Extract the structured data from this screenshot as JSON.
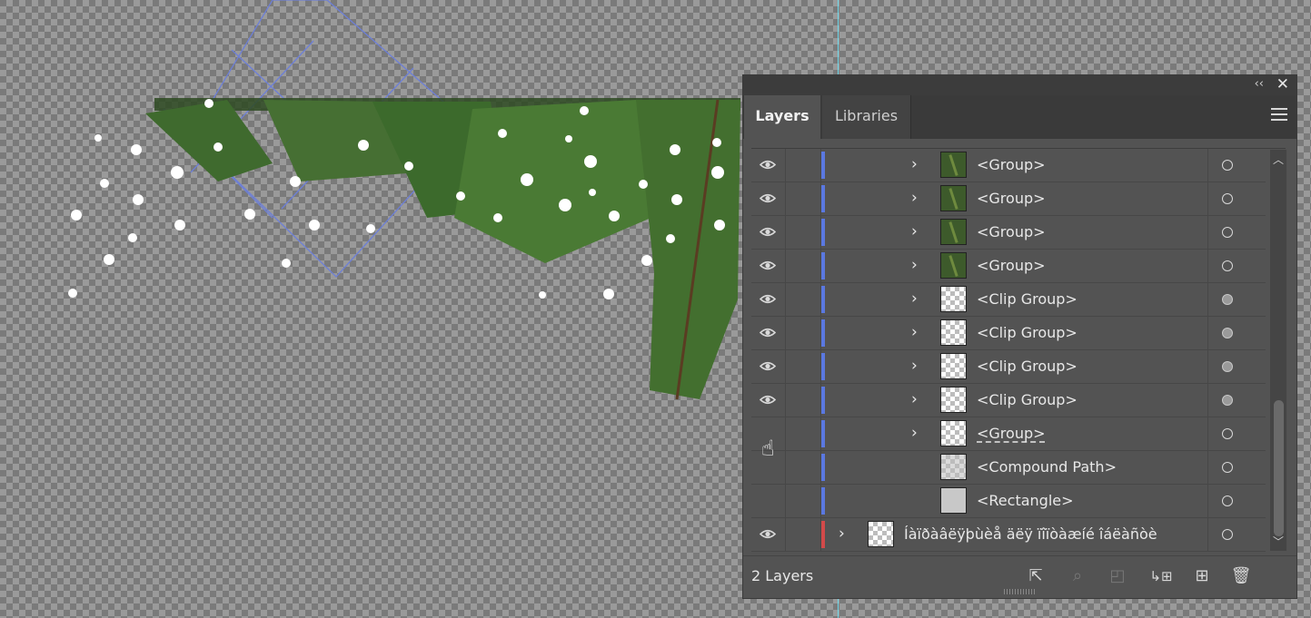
{
  "panel": {
    "tabs": [
      {
        "label": "Layers",
        "active": true
      },
      {
        "label": "Libraries",
        "active": false
      }
    ],
    "collapse_icon": "double-chevron-left-icon",
    "close_icon": "close-icon",
    "menu_icon": "hamburger-menu-icon"
  },
  "layers": {
    "rows": [
      {
        "name": "<Group>",
        "visible": true,
        "expandable": true,
        "thumb": "branch",
        "color": "#5a78e0",
        "target": "empty"
      },
      {
        "name": "<Group>",
        "visible": true,
        "expandable": true,
        "thumb": "branch",
        "color": "#5a78e0",
        "target": "empty"
      },
      {
        "name": "<Group>",
        "visible": true,
        "expandable": true,
        "thumb": "branch",
        "color": "#5a78e0",
        "target": "empty"
      },
      {
        "name": "<Group>",
        "visible": true,
        "expandable": true,
        "thumb": "branch",
        "color": "#5a78e0",
        "target": "empty"
      },
      {
        "name": "<Clip Group>",
        "visible": true,
        "expandable": true,
        "thumb": "checker",
        "color": "#5a78e0",
        "target": "filled"
      },
      {
        "name": "<Clip Group>",
        "visible": true,
        "expandable": true,
        "thumb": "checker",
        "color": "#5a78e0",
        "target": "filled"
      },
      {
        "name": "<Clip Group>",
        "visible": true,
        "expandable": true,
        "thumb": "checker",
        "color": "#5a78e0",
        "target": "filled"
      },
      {
        "name": "<Clip Group>",
        "visible": true,
        "expandable": true,
        "thumb": "checker",
        "color": "#5a78e0",
        "target": "filled"
      },
      {
        "name": "<Group>",
        "visible": false,
        "expandable": true,
        "thumb": "checker",
        "color": "#5a78e0",
        "target": "empty",
        "editing": true
      },
      {
        "name": "<Compound Path>",
        "visible": false,
        "expandable": false,
        "thumb": "partial",
        "color": "#5a78e0",
        "target": "empty"
      },
      {
        "name": "<Rectangle>",
        "visible": false,
        "expandable": false,
        "thumb": "gray",
        "color": "#5a78e0",
        "target": "empty"
      },
      {
        "name": "Íàïðàâëÿþùèå äëÿ ïîïòàæíé îáëàñòè",
        "visible": true,
        "expandable": true,
        "thumb": "checker",
        "color": "#d24a4a",
        "target": "empty",
        "top_level": true
      }
    ]
  },
  "footer": {
    "count_label": "2 Layers",
    "buttons": [
      {
        "name": "export-icon",
        "label": "⇱",
        "enabled": true
      },
      {
        "name": "locate-object-icon",
        "label": "⌕",
        "enabled": false
      },
      {
        "name": "clipping-mask-icon",
        "label": "◰",
        "enabled": false
      },
      {
        "name": "new-sublayer-icon",
        "label": "↳⊞",
        "enabled": true
      },
      {
        "name": "new-layer-icon",
        "label": "⊞",
        "enabled": true
      },
      {
        "name": "trash-icon",
        "label": "🗑",
        "enabled": true
      }
    ]
  },
  "colors": {
    "panel_bg": "#535353",
    "selection_blue": "#5a78e0",
    "layer_red": "#d24a4a",
    "guide": "#6fd6e8"
  }
}
